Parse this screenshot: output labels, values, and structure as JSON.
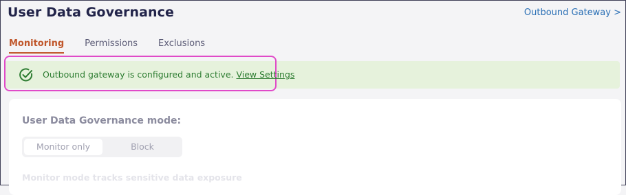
{
  "header": {
    "title": "User Data Governance",
    "outbound_link": "Outbound Gateway >"
  },
  "tabs": [
    {
      "label": "Monitoring",
      "active": true
    },
    {
      "label": "Permissions",
      "active": false
    },
    {
      "label": "Exclusions",
      "active": false
    }
  ],
  "banner": {
    "icon": "check-circle-icon",
    "message": "Outbound gateway is configured and active.",
    "link_label": "View Settings",
    "color": "#2e7d32",
    "background": "#e6f2dc",
    "highlight_color": "#e04ac8"
  },
  "mode": {
    "label": "User Data Governance mode:",
    "options": [
      "Monitor only",
      "Block"
    ],
    "selected": "Monitor only",
    "description": "Monitor mode tracks sensitive data exposure"
  },
  "colors": {
    "accent_tab": "#c0562a",
    "title": "#22244a",
    "link": "#2a6fb5"
  }
}
